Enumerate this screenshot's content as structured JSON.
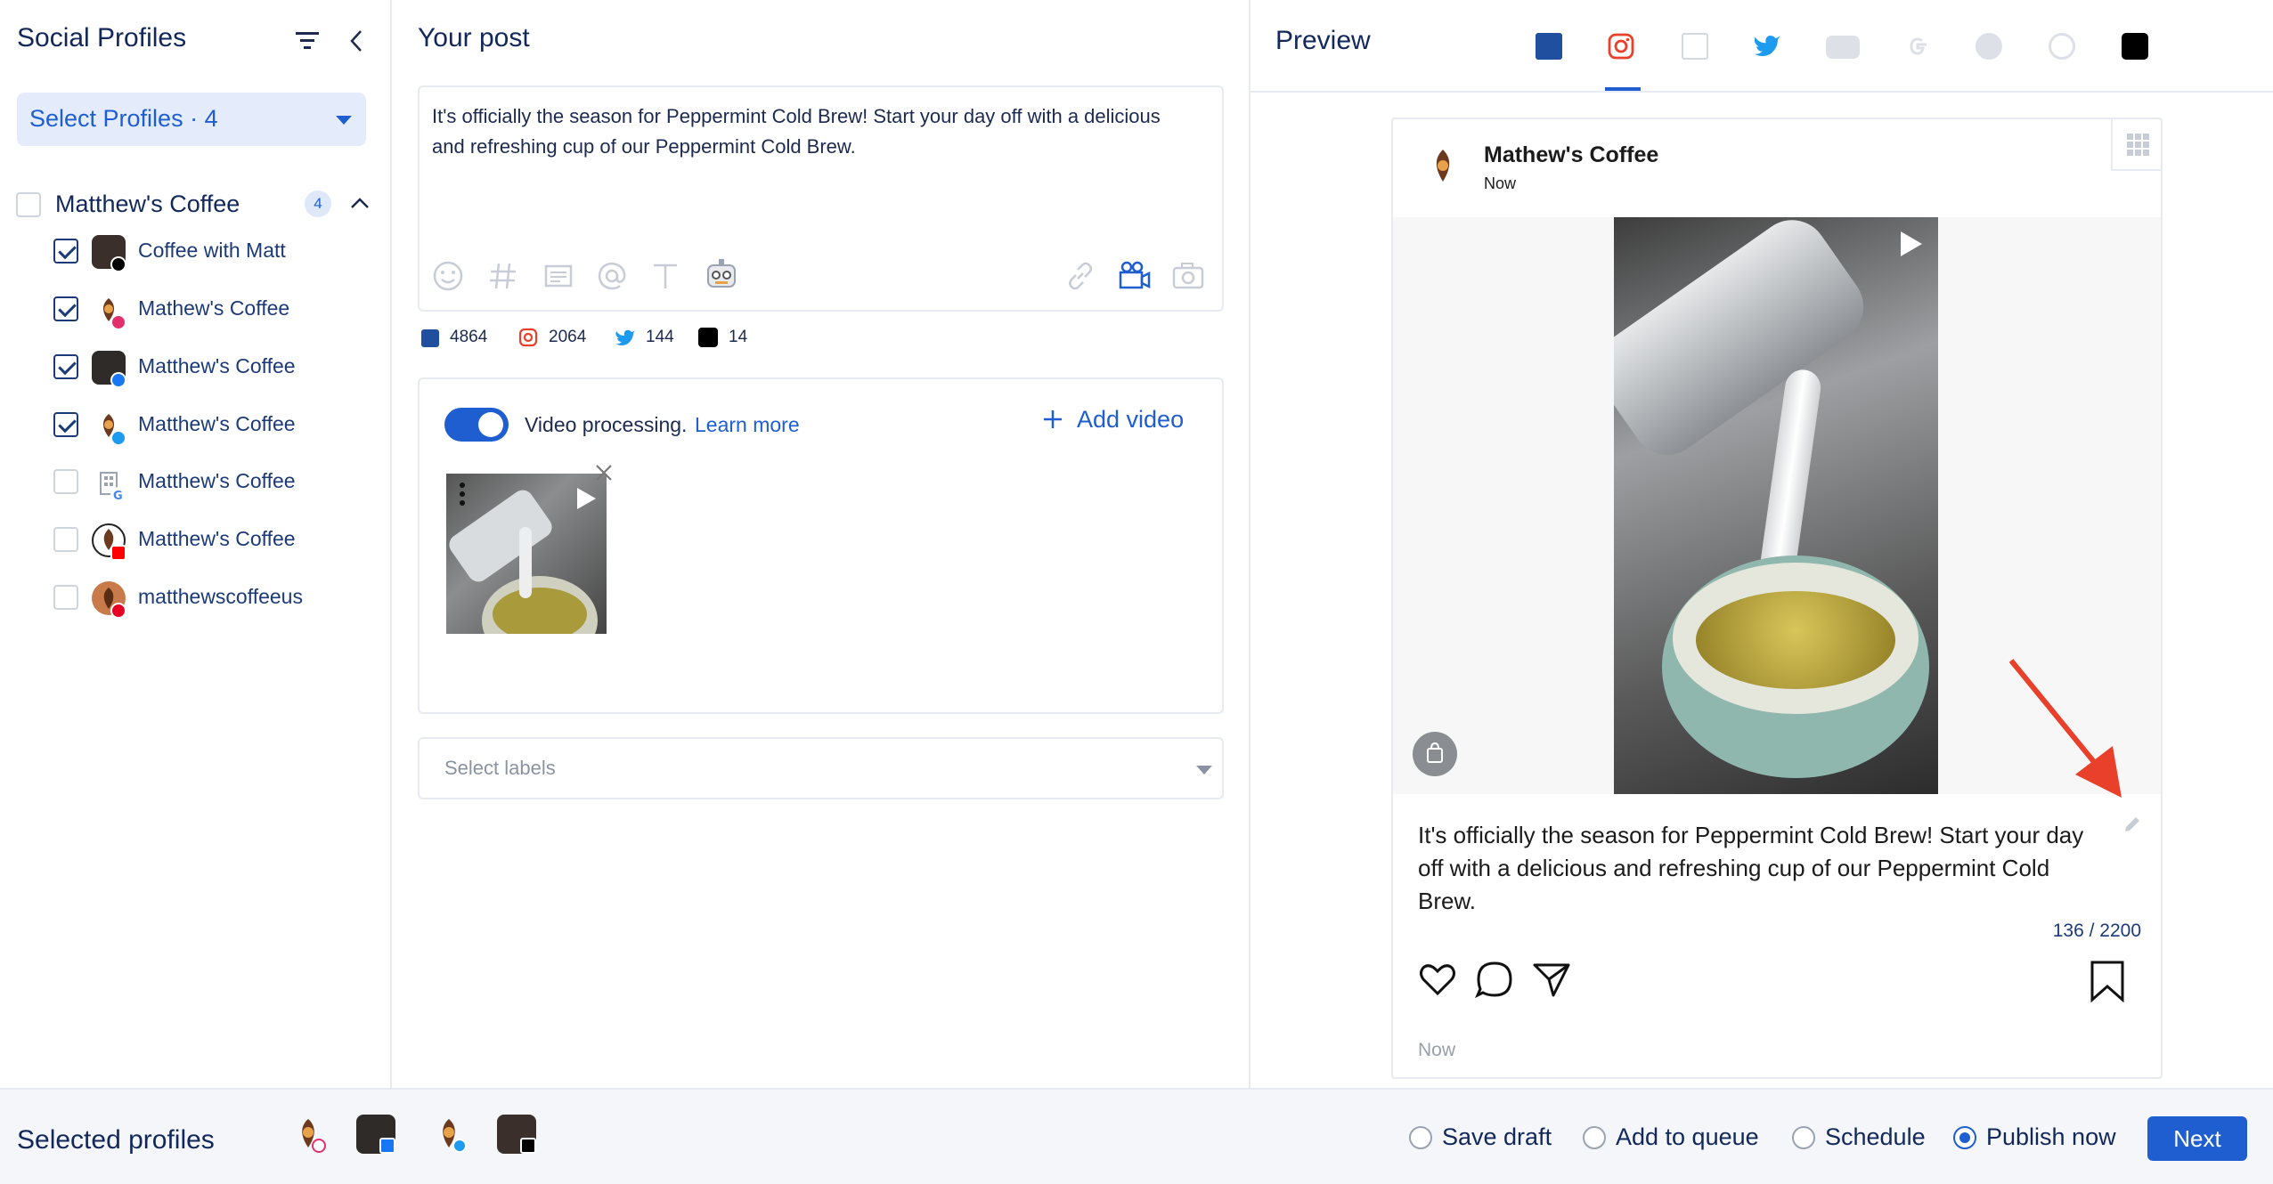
{
  "left": {
    "title": "Social Profiles",
    "select_profiles_label": "Select Profiles · 4",
    "group": {
      "name": "Matthew's Coffee",
      "count": "4"
    },
    "profiles": [
      {
        "label": "Coffee with Matt",
        "checked": true,
        "network": "tiktok"
      },
      {
        "label": "Mathew's Coffee",
        "checked": true,
        "network": "instagram"
      },
      {
        "label": "Matthew's Coffee",
        "checked": true,
        "network": "facebook"
      },
      {
        "label": "Matthew's Coffee",
        "checked": true,
        "network": "twitter"
      },
      {
        "label": "Matthew's Coffee",
        "checked": false,
        "network": "google"
      },
      {
        "label": "Matthew's Coffee",
        "checked": false,
        "network": "youtube"
      },
      {
        "label": "matthewscoffeeus",
        "checked": false,
        "network": "pinterest"
      }
    ]
  },
  "middle": {
    "title": "Your post",
    "post_text": "It's officially the season for Peppermint Cold Brew! Start your day off with a delicious and refreshing cup of our Peppermint Cold Brew.",
    "counts": {
      "facebook": "4864",
      "instagram": "2064",
      "twitter": "144",
      "tiktok": "14"
    },
    "video_processing": "Video processing.",
    "learn_more": "Learn more",
    "add_video": "Add video",
    "select_labels": "Select labels"
  },
  "preview": {
    "title": "Preview",
    "tabs": [
      "facebook",
      "instagram",
      "linkedin",
      "twitter",
      "youtube",
      "google",
      "reddit",
      "pinterest",
      "tiktok"
    ],
    "active_tab": "instagram",
    "account_name": "Mathew's Coffee",
    "time": "Now",
    "caption": "It's officially the season for Peppermint Cold Brew! Start your day off with a delicious and refreshing cup of our Peppermint Cold Brew.",
    "char_count": "136 / 2200",
    "footer_time": "Now"
  },
  "footer": {
    "selected_profiles": "Selected profiles",
    "options": [
      "Save draft",
      "Add to queue",
      "Schedule",
      "Publish now"
    ],
    "selected_option": "Publish now",
    "next_label": "Next"
  },
  "colors": {
    "accent": "#1f5ed1",
    "navy": "#12285a",
    "annotation_arrow": "#e8402a"
  }
}
